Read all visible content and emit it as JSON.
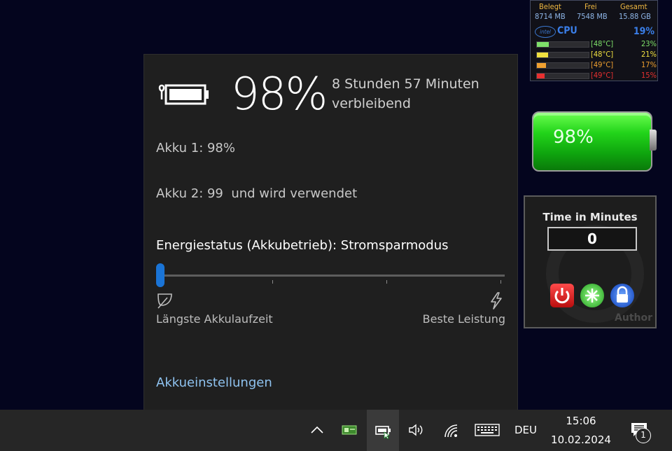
{
  "flyout": {
    "percent": "98%",
    "remaining": "8 Stunden 57 Minuten verbleibend",
    "akku1": "Akku 1: 98%",
    "akku2": "Akku 2: 99  und wird verwendet",
    "energy_status": "Energiestatus (Akkubetrieb): Stromsparmodus",
    "slider_value": 0,
    "slider_left_label": "Längste Akkulaufzeit",
    "slider_right_label": "Beste Leistung",
    "settings_link": "Akkueinstellungen",
    "accent": "#1a74d6"
  },
  "sysmon": {
    "headers": [
      "Belegt",
      "Frei",
      "Gesamt"
    ],
    "values": [
      "8714 MB",
      "7548 MB",
      "15.88 GB"
    ],
    "brand": "intel",
    "cpu_label": "CPU",
    "cpu_total": "19%",
    "cores": [
      {
        "temp": "[48°C]",
        "pct": "23%",
        "color": "#7ee06a",
        "level": 0.23
      },
      {
        "temp": "[48°C]",
        "pct": "21%",
        "color": "#f0e040",
        "level": 0.21
      },
      {
        "temp": "[49°C]",
        "pct": "17%",
        "color": "#f0a030",
        "level": 0.17
      },
      {
        "temp": "[49°C]",
        "pct": "15%",
        "color": "#e83030",
        "level": 0.15
      }
    ]
  },
  "big_battery": {
    "percent": "98%",
    "level": 0.98
  },
  "timer": {
    "title": "Time in Minutes",
    "value": "0",
    "author": "Author"
  },
  "taskbar": {
    "language": "DEU",
    "time": "15:06",
    "date": "10.02.2024",
    "notifications": "1",
    "icons": [
      "chevron-up-icon",
      "gpu-tray-icon",
      "battery-tray-icon",
      "volume-icon",
      "wifi-icon",
      "keyboard-icon",
      "action-center-icon"
    ]
  }
}
